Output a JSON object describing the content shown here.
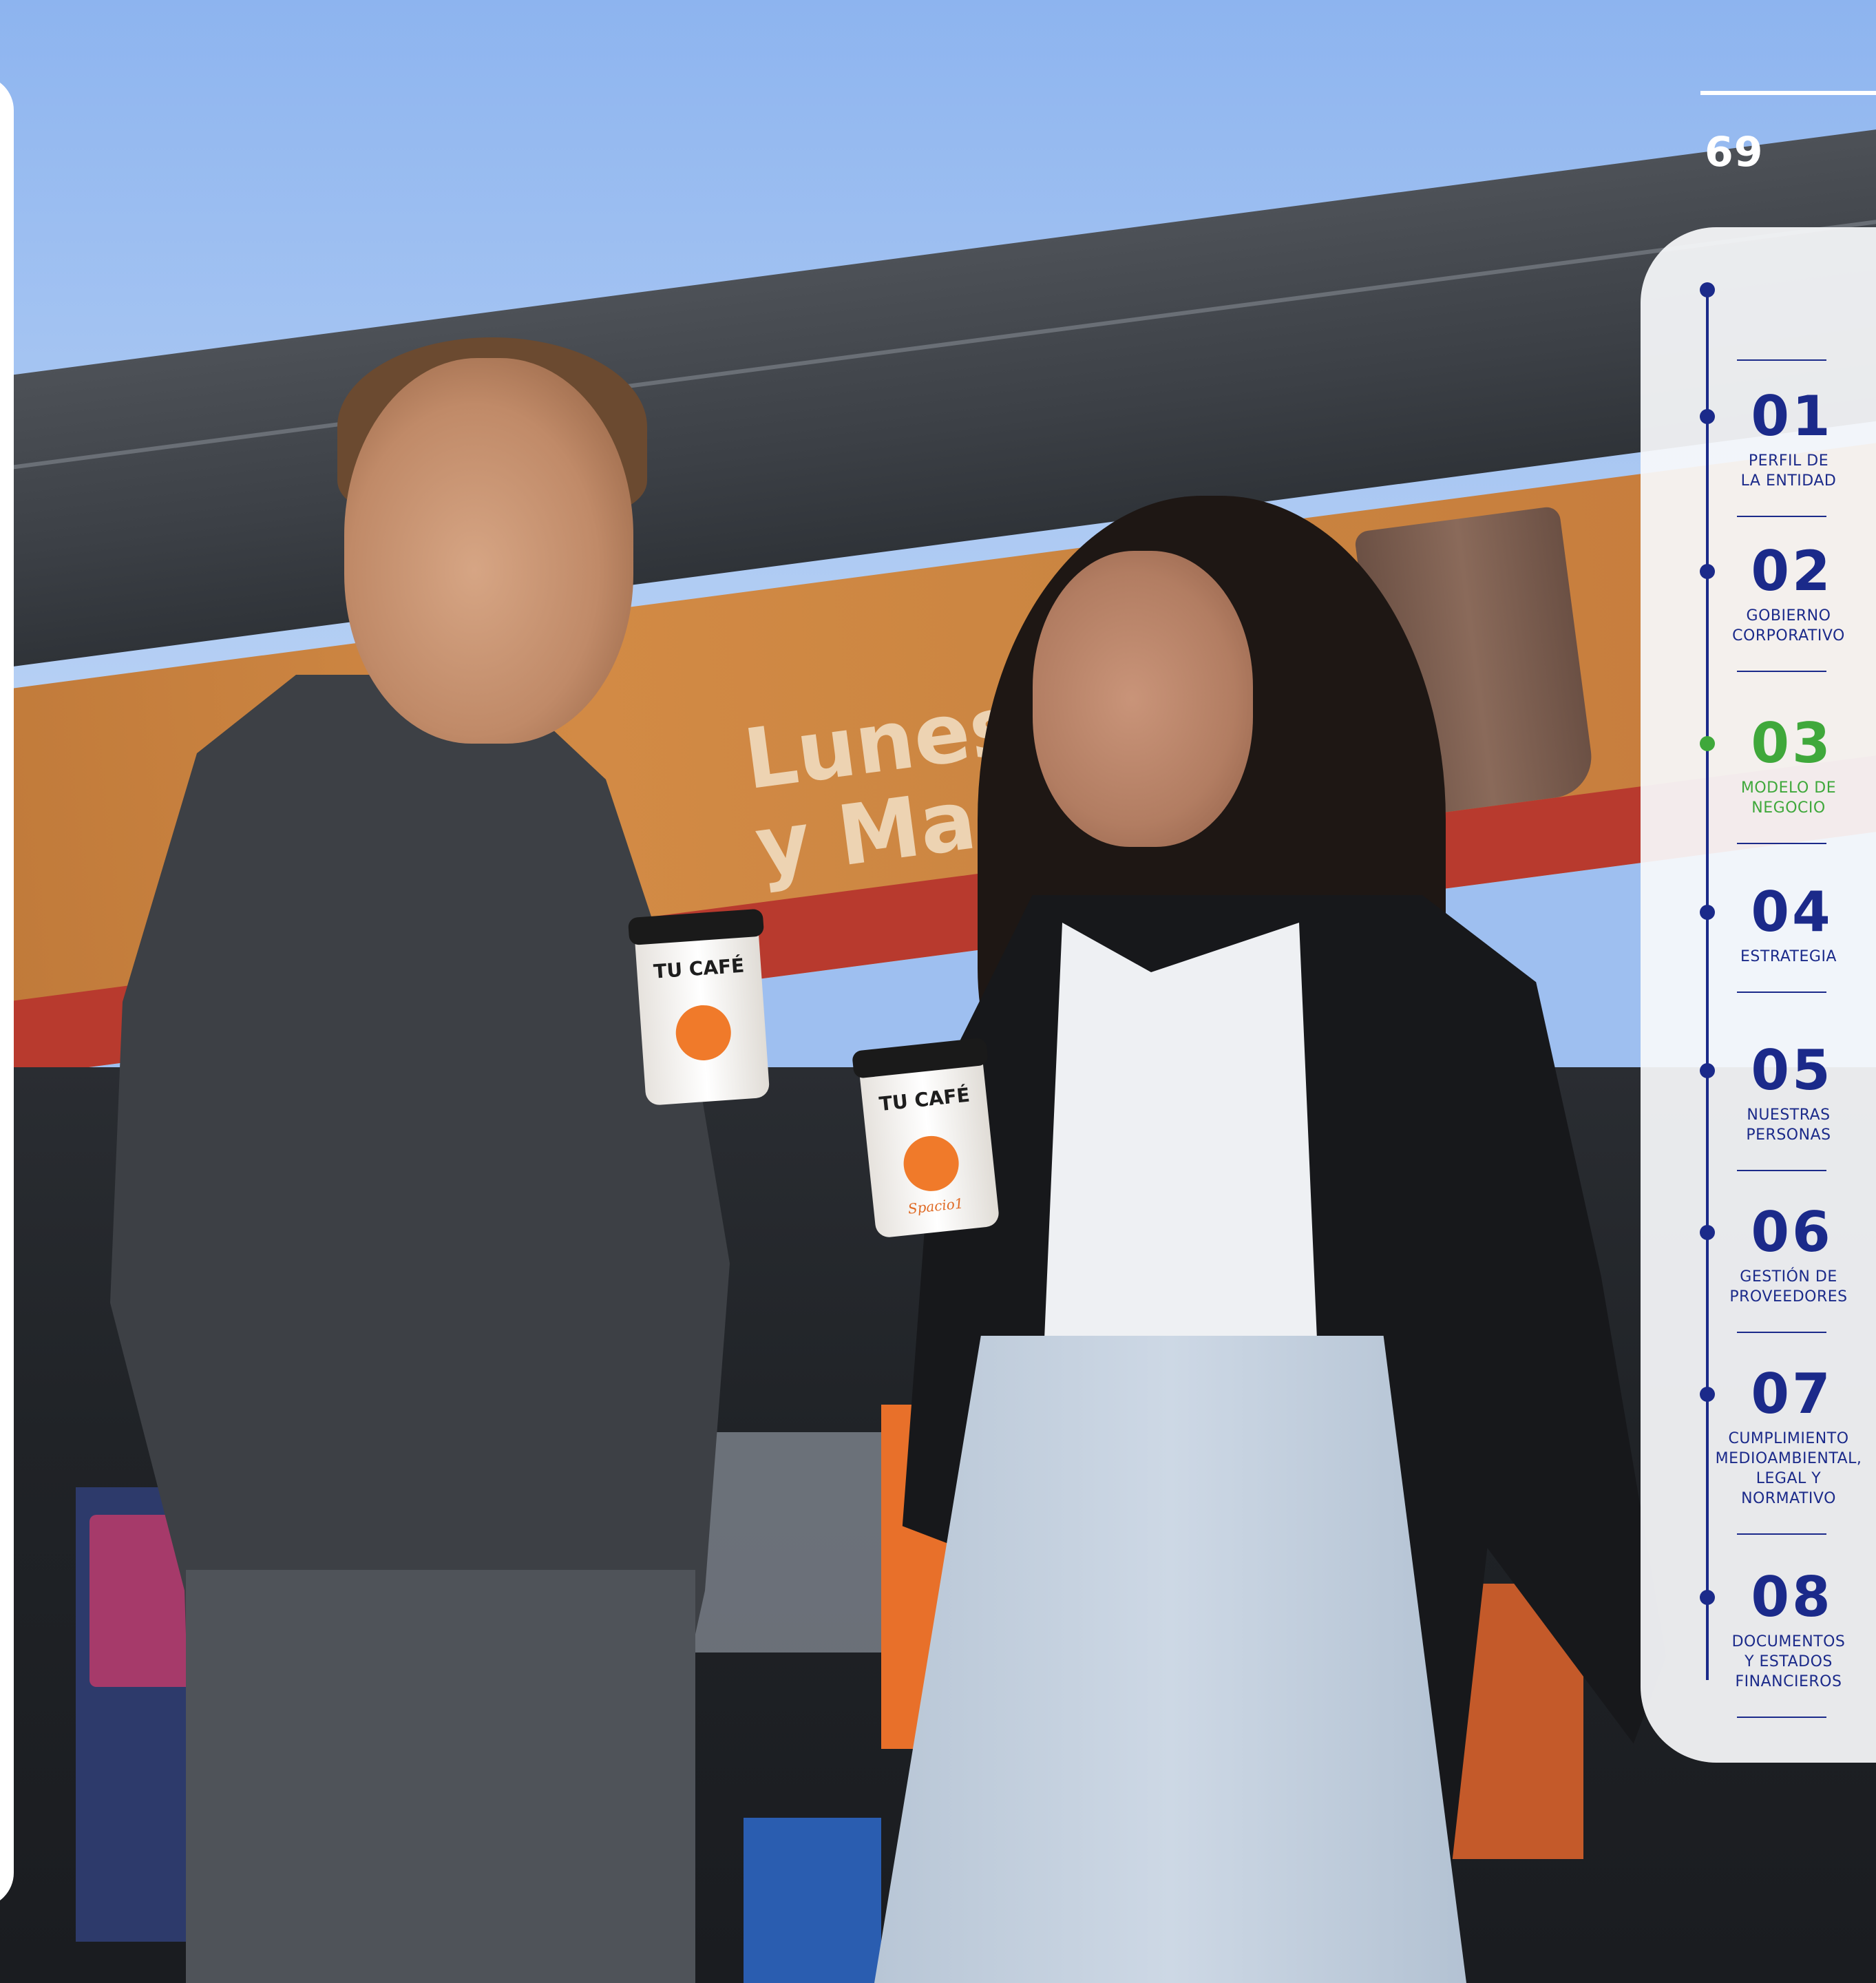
{
  "page": {
    "number": "69"
  },
  "photo": {
    "banner_text": "Lunes\ny Martes",
    "cup_title": "TU CAFÉ",
    "cup_brand": "Spacio1"
  },
  "colors": {
    "nav_accent": "#1b2a8a",
    "active_accent": "#3fa83b",
    "sidebar_bg": "#f8f9fb"
  },
  "nav": {
    "active_index": 2,
    "items": [
      {
        "number": "01",
        "label": "PERFIL DE\nLA ENTIDAD"
      },
      {
        "number": "02",
        "label": "GOBIERNO\nCORPORATIVO"
      },
      {
        "number": "03",
        "label": "MODELO DE\nNEGOCIO"
      },
      {
        "number": "04",
        "label": "ESTRATEGIA"
      },
      {
        "number": "05",
        "label": "NUESTRAS\nPERSONAS"
      },
      {
        "number": "06",
        "label": "GESTIÓN DE\nPROVEEDORES"
      },
      {
        "number": "07",
        "label": "CUMPLIMIENTO\nMEDIOAMBIENTAL,\nLEGAL Y\nNORMATIVO"
      },
      {
        "number": "08",
        "label": "DOCUMENTOS\nY ESTADOS\nFINANCIEROS"
      }
    ]
  }
}
